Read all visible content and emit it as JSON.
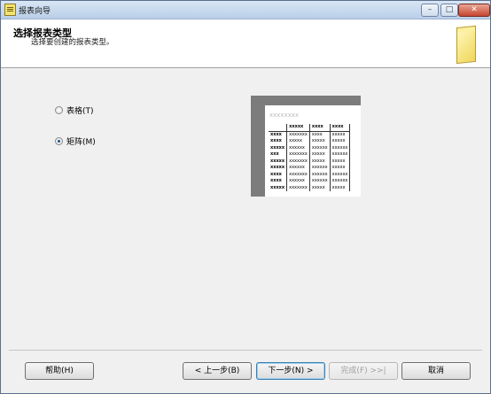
{
  "window": {
    "title": "报表向导"
  },
  "title_buttons": {
    "minimize": "–",
    "maximize": "□",
    "close": "✕"
  },
  "header": {
    "title": "选择报表类型",
    "subtitle": "选择要创建的报表类型。"
  },
  "options": [
    {
      "label": "表格(T)",
      "checked": false
    },
    {
      "label": "矩阵(M)",
      "checked": true
    }
  ],
  "preview": {
    "title": "xxxxxxxx",
    "header": [
      "",
      "xxxxx",
      "xxxx",
      "xxxx"
    ],
    "rows": [
      [
        "xxxx",
        "xxxxxxx",
        "xxxx",
        "xxxxx"
      ],
      [
        "xxxx",
        "xxxxx",
        "xxxxx",
        "xxxxx"
      ],
      [
        "xxxxx",
        "xxxxxx",
        "xxxxxx",
        "xxxxxx"
      ],
      [
        "xxx",
        "xxxxxxx",
        "xxxxx",
        "xxxxxx"
      ],
      [
        "xxxxx",
        "xxxxxxx",
        "xxxxx",
        "xxxxx"
      ],
      [
        "xxxxx",
        "xxxxxx",
        "xxxxxx",
        "xxxxx"
      ],
      [
        "xxxx",
        "xxxxxxx",
        "xxxxxx",
        "xxxxxx"
      ],
      [
        "xxxx",
        "xxxxxx",
        "xxxxxx",
        "xxxxxx"
      ],
      [
        "xxxxx",
        "xxxxxxx",
        "xxxxx",
        "xxxxx"
      ]
    ]
  },
  "buttons": {
    "help": "帮助(H)",
    "back": "< 上一步(B)",
    "next": "下一步(N) >",
    "finish": "完成(F) >>|",
    "cancel": "取消"
  }
}
